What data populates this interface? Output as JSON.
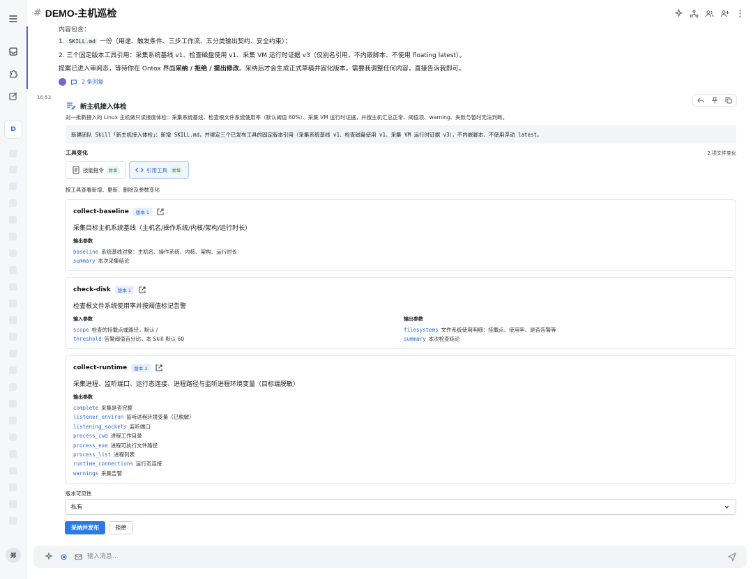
{
  "header": {
    "hash": "#",
    "title": "DEMO-主机巡检"
  },
  "top_message": {
    "cut_line": "内容包含：",
    "items": [
      {
        "prefix": "1. ",
        "code": "SKILL.md",
        "text": " 一份（用途、触发条件、三步工作流、五分类输出契约、安全约束）；"
      },
      {
        "prefix": "2. ",
        "code": "",
        "text": "三个固定版本工具引用：采集系统基线 v1、检查磁盘使用 v1、采集 VM 运行时证据 v3（仅别名引用，不内嵌脚本、不使用 floating latest）。"
      }
    ],
    "para_prefix": "提案已进入审阅态，等待你在 Ontox 界面",
    "para_bold": "采纳 / 拒绝 / 提出修改",
    "para_suffix": "。采纳后才会生成正式草稿并固化版本。需要我调整任何内容，直接告诉我即可。",
    "replies": "2 条回复"
  },
  "timestamp": "16:53",
  "card": {
    "title": "新主机接入体检",
    "description": "对一批新接入的 Linux 主机做只读接度体检：采集系统基线、检查根文件系统使用率（默认阈值 60%）、采集 VM 运行时证据，并按主机汇总正常、阈值项、warning、失败与暂时无法判断。",
    "code_summary": "新建团队 Skill「新主机接入体检」：新增 SKILL.md，并绑定三个已发布工具的固定版本引用（采集系统基线 v1、检查磁盘使用 v1、采集 VM 运行时证据 v3），不内嵌脚本、不使用浮动 latest。",
    "changes_label": "工具变化",
    "changes_count": "2 项文件变化",
    "tabs": [
      {
        "label": "技能指令",
        "tag": "新增"
      },
      {
        "label": "引用工具",
        "tag": "新增"
      }
    ],
    "hint": "按工具查看新增、更新、删除及参数变化",
    "tools": [
      {
        "name": "collect-baseline",
        "version": "版本 1",
        "desc": "采集目标主机系统基线（主机名/操作系统/内核/架构/运行时长）",
        "output_label": "输出参数",
        "outputs": [
          {
            "name": "baseline",
            "desc": "系统基线对象：主机名、操作系统、内核、架构、运行时长"
          },
          {
            "name": "summary",
            "desc": "本次采集结论"
          }
        ]
      },
      {
        "name": "check-disk",
        "version": "版本 1",
        "desc": "检查根文件系统使用率并按阈值标记告警",
        "input_label": "输入参数",
        "inputs": [
          {
            "name": "scope",
            "desc": "检查的挂载点或路径，默认 /"
          },
          {
            "name": "threshold",
            "desc": "告警阈值百分比，本 Skill 默认 60"
          }
        ],
        "output_label": "输出参数",
        "outputs": [
          {
            "name": "filesystems",
            "desc": "文件系统使用明细：挂载点、使用率、是否告警等"
          },
          {
            "name": "summary",
            "desc": "本次检查结论"
          }
        ]
      },
      {
        "name": "collect-runtime",
        "version": "版本 3",
        "desc": "采集进程、监听端口、运行态连接、进程路径与监听进程环境变量（目标端脱敏）",
        "output_label": "输出参数",
        "outputs": [
          {
            "name": "complete",
            "desc": "采集是否完整"
          },
          {
            "name": "listener_environ",
            "desc": "监听进程环境变量（已脱敏）"
          },
          {
            "name": "listening_sockets",
            "desc": "监听端口"
          },
          {
            "name": "process_cwd",
            "desc": "进程工作目录"
          },
          {
            "name": "process_exe",
            "desc": "进程可执行文件路径"
          },
          {
            "name": "process_list",
            "desc": "进程列表"
          },
          {
            "name": "runtime_connections",
            "desc": "运行态连接"
          },
          {
            "name": "warnings",
            "desc": "采集告警"
          }
        ]
      }
    ],
    "visibility_label": "版本可见性",
    "visibility_value": "私有",
    "approve_label": "采纳并发布",
    "reject_label": "拒绝"
  },
  "composer": {
    "placeholder": "输入消息..."
  },
  "rail": {
    "workspace_letter": "D",
    "user_initial": "郑"
  },
  "colors": {
    "accent": "#2c7be5",
    "link": "#2c6ad8",
    "thread_bar": "#6b5bd6"
  }
}
